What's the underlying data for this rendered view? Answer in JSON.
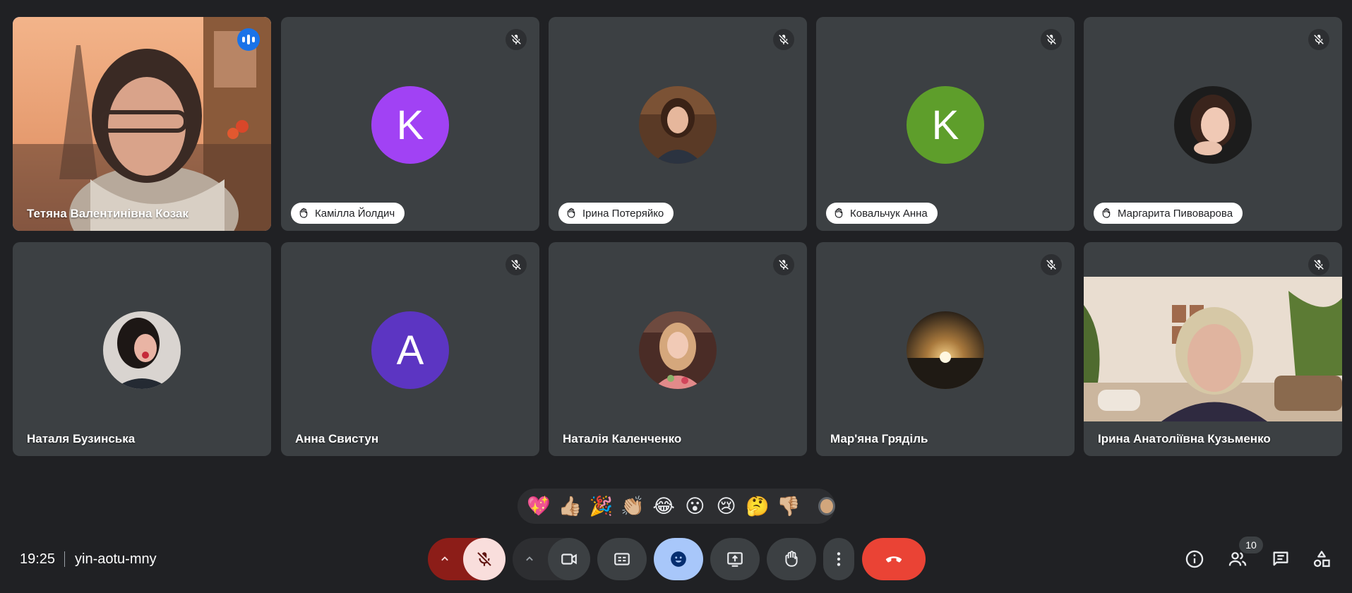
{
  "participants": [
    {
      "name": "Тетяна Валентинівна Козак",
      "state": "video-speaking"
    },
    {
      "name": "Камілла Йолдич",
      "initial": "K",
      "avatar_color": "#a142f4",
      "hand_raised": true,
      "muted": true
    },
    {
      "name": "Ірина Потеряйко",
      "avatar": "photo",
      "hand_raised": true,
      "muted": true
    },
    {
      "name": "Ковальчук Анна",
      "initial": "K",
      "avatar_color": "#5e9e2b",
      "hand_raised": true,
      "muted": true
    },
    {
      "name": "Маргарита Пивоварова",
      "avatar": "photo",
      "hand_raised": true,
      "muted": true
    },
    {
      "name": "Наталя Бузинська",
      "avatar": "photo",
      "muted": false
    },
    {
      "name": "Анна Свистун",
      "initial": "A",
      "avatar_color": "#5c35c2",
      "muted": true
    },
    {
      "name": "Наталія Каленченко",
      "avatar": "photo",
      "muted": true
    },
    {
      "name": "Мар'яна Гряділь",
      "avatar": "photo-sunset",
      "muted": true
    },
    {
      "name": "Ірина Анатоліївна Кузьменко",
      "state": "video",
      "muted": true
    }
  ],
  "reactions": [
    "💖",
    "👍🏼",
    "🎉",
    "👏🏼",
    "😂",
    "😮",
    "😢",
    "🤔",
    "👎🏼"
  ],
  "meeting": {
    "time": "19:25",
    "code": "yin-aotu-mny"
  },
  "people_count": "10",
  "colors": {
    "background": "#202124",
    "tile": "#3c4043",
    "accent_blue": "#8ab4f8",
    "end_call_red": "#ea4335",
    "mic_off_bg": "#f9dedc",
    "mic_off_caret_bg": "#8c1d18",
    "reactions_active_bg": "#a8c7fa"
  },
  "icons": {
    "mute": "mic-off-icon",
    "hand": "hand-raised-icon",
    "camera": "videocam-icon",
    "captions": "captions-icon",
    "emoji": "emoji-icon",
    "present": "present-screen-icon",
    "raise_hand": "raise-hand-icon",
    "more": "more-vert-icon",
    "end_call": "call-end-icon",
    "info": "info-icon",
    "people": "people-icon",
    "chat": "chat-icon",
    "activities": "activities-icon"
  }
}
